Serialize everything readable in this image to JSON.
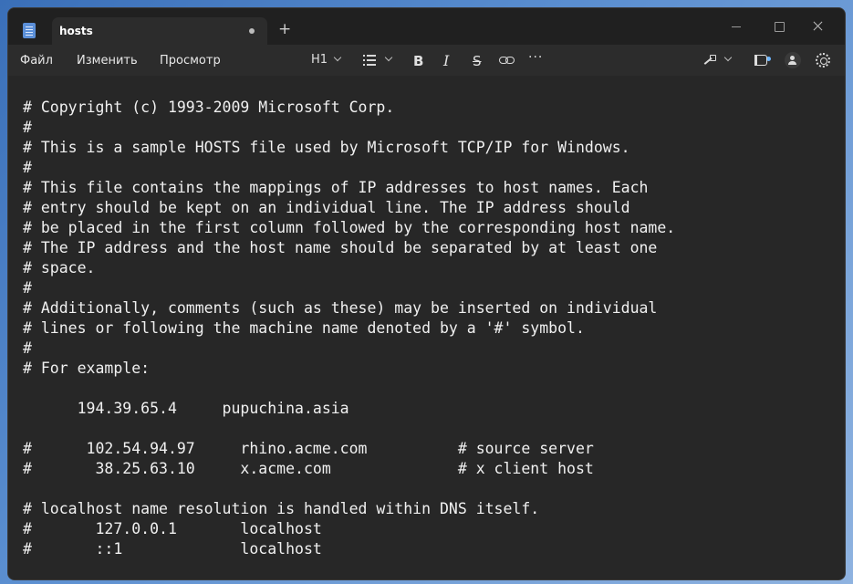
{
  "window": {
    "tab_title": "hosts",
    "new_tab_icon": "plus-icon"
  },
  "menubar": {
    "file": "Файл",
    "edit": "Изменить",
    "view": "Просмотр"
  },
  "toolbar": {
    "heading": "H1",
    "list_icon": "list-icon",
    "bold": "B",
    "italic": "I",
    "strikethrough": "S",
    "link_icon": "link-icon",
    "more": "···",
    "copilot_icon": "copilot-icon",
    "whats_new_icon": "megaphone-icon",
    "account_icon": "account-icon",
    "settings_icon": "gear-icon"
  },
  "colors": {
    "background": "#272727",
    "titlebar": "#202020",
    "menubar": "#2c2c2c",
    "text": "#f0f0f0",
    "notification_dot": "#6db6ff"
  },
  "document": {
    "lines": [
      "# Copyright (c) 1993-2009 Microsoft Corp.",
      "#",
      "# This is a sample HOSTS file used by Microsoft TCP/IP for Windows.",
      "#",
      "# This file contains the mappings of IP addresses to host names. Each",
      "# entry should be kept on an individual line. The IP address should",
      "# be placed in the first column followed by the corresponding host name.",
      "# The IP address and the host name should be separated by at least one",
      "# space.",
      "#",
      "# Additionally, comments (such as these) may be inserted on individual",
      "# lines or following the machine name denoted by a '#' symbol.",
      "#",
      "# For example:",
      "",
      "      194.39.65.4     pupuchina.asia",
      "",
      "#      102.54.94.97     rhino.acme.com          # source server",
      "#       38.25.63.10     x.acme.com              # x client host",
      "",
      "# localhost name resolution is handled within DNS itself.",
      "#       127.0.0.1       localhost",
      "#       ::1             localhost"
    ]
  }
}
